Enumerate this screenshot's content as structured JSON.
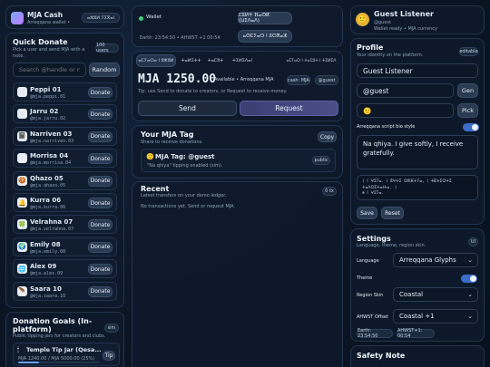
{
  "app": {
    "title": "MJA Cash",
    "subtitle": "Arreqqana wallet •",
    "badge": "ⴰⵣⵓⵍ ⵢⵉⴳⴰⵏ"
  },
  "quick_donate": {
    "title": "Quick Donate",
    "description": "Pick a user and send MJA with a note.",
    "count": "100 users",
    "search_placeholder": "Search @handle or name",
    "random_label": "Random",
    "donate_label": "Donate",
    "creators": [
      {
        "name": "Peppi 01",
        "handle": "@mja.peppi.01",
        "icon": "🐱"
      },
      {
        "name": "Jarru 02",
        "handle": "@mja.jarru.02",
        "icon": "🖼"
      },
      {
        "name": "Narriven 03",
        "handle": "@mja.narriven.03",
        "icon": "📓"
      },
      {
        "name": "Morrisa 04",
        "handle": "@mja.morrisa.04",
        "icon": "✴"
      },
      {
        "name": "Qhazo 05",
        "handle": "@mja.qhazo.05",
        "icon": "🍪"
      },
      {
        "name": "Kurra 06",
        "handle": "@mja.kurra.06",
        "icon": "🔔"
      },
      {
        "name": "Velrahna 07",
        "handle": "@mja.velrahna.07",
        "icon": "🍀"
      },
      {
        "name": "Emily 08",
        "handle": "@mja.emily.08",
        "icon": "🌍"
      },
      {
        "name": "Alex 09",
        "handle": "@mja.alex.09",
        "icon": "🌐"
      },
      {
        "name": "Saara 10",
        "handle": "@mja.saara.10",
        "icon": "🪶"
      }
    ]
  },
  "goals": {
    "title": "Donation Goals (In-platform)",
    "description": "Public tipping jars for creators and clubs.",
    "badge": "sim",
    "item_title": "Temple Tip Jar (Qesa...",
    "item_sub": "MJA 1240.00 / MJA 5000.00 (25%)",
    "progress": 0.25,
    "tip_label": "Tip"
  },
  "wallet": {
    "label": "Wallet",
    "clock": "Earth: 23:54:50 • AHWST +1 00:54",
    "script_top": "ⵎⵓⵍⵜ ⴼⴰⵙⴽ (ⵡⵉⴷⴰⴷ)",
    "script_bottom": "ⴰⵙⵎⵢⴰⵔ ⵏ ⵓⵔⴳⴰⵣ",
    "tabs": [
      "ⴰⵎⵢⴰⵔⴰ ⵏ ⵓⵣⵓⵍ",
      "ⵜⴰⵍⵉⵜⵜ",
      "ⵜⴰⵎⵓⵜ",
      "ⵜⵉⵍⵉⴷⴰⵏ"
    ],
    "tabs_right": "ⴰⵎⵢⴰⵔ ⵏ ⵜⴰⵎⵓⵜ ⵏ ⵜⵉⵍⵉⴷ",
    "balance": "MJA 1250.00",
    "available": "Available • Arreqqana MJA",
    "cash_chip": "cash: MJA",
    "handle_chip": "@guest",
    "tip": "Tip: use Send to donate to creators, or Request to receive money.",
    "send_label": "Send",
    "request_label": "Request"
  },
  "tag": {
    "title": "Your MJA Tag",
    "description": "Share to receive donations.",
    "copy_label": "Copy",
    "tag_line": "MJA Tag: @guest",
    "tag_sub": "\"Na qhiya\" tipping enabled (sim).",
    "public_label": "public"
  },
  "recent": {
    "title": "Recent",
    "description": "Latest transfers on your demo ledger.",
    "count": "0 tx",
    "empty": "No transactions yet. Send or request MJA."
  },
  "profile_header": {
    "name": "Guest Listener",
    "handle": "@guest",
    "status": "Wallet ready • MJA currency"
  },
  "profile": {
    "title": "Profile",
    "description": "Your identity on the platform.",
    "editable": "editable",
    "name_value": "Guest Listener",
    "handle_value": "@guest",
    "gen_label": "Gen",
    "avatar_value": "🙂",
    "pick_label": "Pick",
    "script_bio_label": "Arreqqana script bio style",
    "script_bio_on": true,
    "bio_value": "Na qhiya. I give softly, I receive gratefully.",
    "bio_script": "( ⵏ ⵖⵉⵢⴰ. ⵏ ⵓⵖⵜⵉ ⵙⵓⴼⵜⵢⴰ, ⵏ ⵜⴽⵜⵉⵔⵜⵉ ⵜⴰⴷⵔⵉⵜⴰⵏⵜⴰ. )\n⊛ ⵏ ⵖⵉⵢⴰ.",
    "save_label": "Save",
    "reset_label": "Reset"
  },
  "settings": {
    "title": "Settings",
    "description": "Language, theme, region skin.",
    "ui_badge": "UI",
    "language_label": "Language",
    "language_value": "Arreqqana Glyphs",
    "theme_label": "Theme",
    "theme_on": true,
    "region_label": "Region Skin",
    "region_value": "Coastal",
    "offset_label": "AHWST Offset",
    "offset_value": "Coastal +1",
    "earth_time": "Earth: 23:54:50",
    "ahwst_time": "AHWST+1: 00:54"
  },
  "safety": {
    "title": "Safety Note"
  }
}
